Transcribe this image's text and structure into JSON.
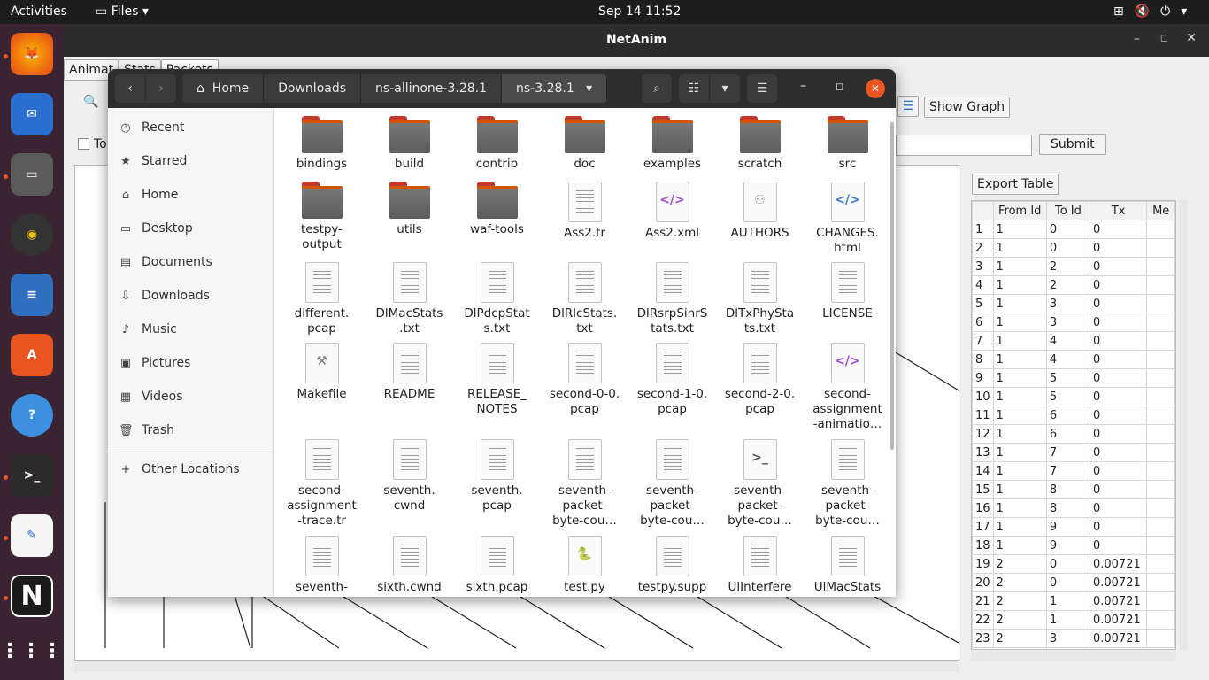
{
  "topbar": {
    "activities": "Activities",
    "app": "Files",
    "clock": "Sep 14  11:52"
  },
  "netanim": {
    "title": "NetAnim",
    "tabs": [
      "Animat",
      "Stats",
      "Packets"
    ],
    "show_graph": "Show Graph",
    "submit": "Submit",
    "export_table": "Export Table",
    "checkbox_label": "To",
    "table": {
      "headers": [
        "From Id",
        "To Id",
        "Tx",
        "Me"
      ],
      "rows": [
        [
          "1",
          "1",
          "0",
          "0"
        ],
        [
          "2",
          "1",
          "0",
          "0"
        ],
        [
          "3",
          "1",
          "2",
          "0"
        ],
        [
          "4",
          "1",
          "2",
          "0"
        ],
        [
          "5",
          "1",
          "3",
          "0"
        ],
        [
          "6",
          "1",
          "3",
          "0"
        ],
        [
          "7",
          "1",
          "4",
          "0"
        ],
        [
          "8",
          "1",
          "4",
          "0"
        ],
        [
          "9",
          "1",
          "5",
          "0"
        ],
        [
          "10",
          "1",
          "5",
          "0"
        ],
        [
          "11",
          "1",
          "6",
          "0"
        ],
        [
          "12",
          "1",
          "6",
          "0"
        ],
        [
          "13",
          "1",
          "7",
          "0"
        ],
        [
          "14",
          "1",
          "7",
          "0"
        ],
        [
          "15",
          "1",
          "8",
          "0"
        ],
        [
          "16",
          "1",
          "8",
          "0"
        ],
        [
          "17",
          "1",
          "9",
          "0"
        ],
        [
          "18",
          "1",
          "9",
          "0"
        ],
        [
          "19",
          "2",
          "0",
          "0.00721"
        ],
        [
          "20",
          "2",
          "0",
          "0.00721"
        ],
        [
          "21",
          "2",
          "1",
          "0.00721"
        ],
        [
          "22",
          "2",
          "1",
          "0.00721"
        ],
        [
          "23",
          "2",
          "3",
          "0.00721"
        ]
      ]
    }
  },
  "files": {
    "breadcrumb": [
      "Home",
      "Downloads",
      "ns-allinone-3.28.1",
      "ns-3.28.1"
    ],
    "sidebar": [
      {
        "label": "Recent",
        "icon": "clock-icon"
      },
      {
        "label": "Starred",
        "icon": "star-icon"
      },
      {
        "label": "Home",
        "icon": "home-icon"
      },
      {
        "label": "Desktop",
        "icon": "desktop-icon"
      },
      {
        "label": "Documents",
        "icon": "documents-icon"
      },
      {
        "label": "Downloads",
        "icon": "download-icon"
      },
      {
        "label": "Music",
        "icon": "music-icon"
      },
      {
        "label": "Pictures",
        "icon": "pictures-icon"
      },
      {
        "label": "Videos",
        "icon": "videos-icon"
      },
      {
        "label": "Trash",
        "icon": "trash-icon"
      },
      {
        "label": "Other Locations",
        "icon": "plus-icon"
      }
    ],
    "items": [
      {
        "label": "bindings",
        "type": "folder"
      },
      {
        "label": "build",
        "type": "folder"
      },
      {
        "label": "contrib",
        "type": "folder"
      },
      {
        "label": "doc",
        "type": "folder"
      },
      {
        "label": "examples",
        "type": "folder"
      },
      {
        "label": "scratch",
        "type": "folder"
      },
      {
        "label": "src",
        "type": "folder"
      },
      {
        "label": "testpy-\noutput",
        "type": "folder"
      },
      {
        "label": "utils",
        "type": "folder"
      },
      {
        "label": "waf-tools",
        "type": "folder"
      },
      {
        "label": "Ass2.tr",
        "type": "text"
      },
      {
        "label": "Ass2.xml",
        "type": "code"
      },
      {
        "label": "AUTHORS",
        "type": "people"
      },
      {
        "label": "CHANGES.\nhtml",
        "type": "code-blue"
      },
      {
        "label": "different.\npcap",
        "type": "text"
      },
      {
        "label": "DlMacStats\n.txt",
        "type": "text"
      },
      {
        "label": "DlPdcpStat\ns.txt",
        "type": "text"
      },
      {
        "label": "DlRlcStats.\ntxt",
        "type": "text"
      },
      {
        "label": "DlRsrpSinrS\ntats.txt",
        "type": "text"
      },
      {
        "label": "DlTxPhySta\nts.txt",
        "type": "text"
      },
      {
        "label": "LICENSE",
        "type": "text"
      },
      {
        "label": "Makefile",
        "type": "tool"
      },
      {
        "label": "README",
        "type": "text"
      },
      {
        "label": "RELEASE_\nNOTES",
        "type": "text"
      },
      {
        "label": "second-0-0.\npcap",
        "type": "text"
      },
      {
        "label": "second-1-0.\npcap",
        "type": "text"
      },
      {
        "label": "second-2-0.\npcap",
        "type": "text"
      },
      {
        "label": "second-\nassignment\n-animatio…",
        "type": "code"
      },
      {
        "label": "second-\nassignment\n-trace.tr",
        "type": "text"
      },
      {
        "label": "seventh.\ncwnd",
        "type": "text"
      },
      {
        "label": "seventh.\npcap",
        "type": "text"
      },
      {
        "label": "seventh-\npacket-\nbyte-cou…",
        "type": "text"
      },
      {
        "label": "seventh-\npacket-\nbyte-cou…",
        "type": "text"
      },
      {
        "label": "seventh-\npacket-\nbyte-cou…",
        "type": "script"
      },
      {
        "label": "seventh-\npacket-\nbyte-cou…",
        "type": "text"
      },
      {
        "label": "seventh-",
        "type": "text"
      },
      {
        "label": "sixth.cwnd",
        "type": "text"
      },
      {
        "label": "sixth.pcap",
        "type": "text"
      },
      {
        "label": "test.py",
        "type": "python"
      },
      {
        "label": "testpy.supp",
        "type": "text"
      },
      {
        "label": "UlInterfere",
        "type": "text"
      },
      {
        "label": "UlMacStats",
        "type": "text"
      }
    ]
  }
}
